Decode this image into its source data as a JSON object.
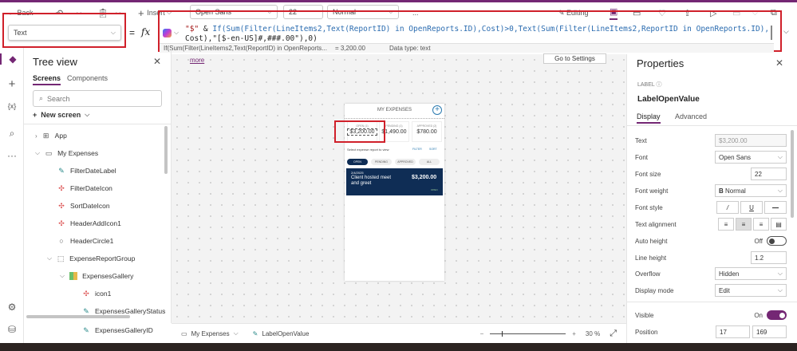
{
  "toolbar": {
    "back": "Back",
    "insert": "Insert",
    "font": "Open Sans",
    "font_size": "22",
    "font_weight": "Normal",
    "more": "...",
    "editing": "Editing"
  },
  "formula_bar": {
    "property": "Text",
    "equals": "=",
    "fx": "fx",
    "line1": [
      "\"$\"",
      " & ",
      "If(Sum(Filter(LineItems2,Text(ReportID) in OpenReports.ID),Cost)>0,Text(Sum(Filter(LineItems2,ReportID in OpenReports.ID),"
    ],
    "line2": "Cost),\"[$-en-US]#,###.00\"),0)",
    "preview": "If(Sum(Filter(LineItems2,Text(ReportID) in OpenReports...",
    "preview_value": "= 3,200.00",
    "data_type": "Data type: text"
  },
  "banner": {
    "more": "more",
    "go_settings": "Go to Settings"
  },
  "tree": {
    "title": "Tree view",
    "tabs": [
      "Screens",
      "Components"
    ],
    "search_placeholder": "Search",
    "new_screen": "New screen",
    "items": [
      "App",
      "My Expenses",
      "FilterDateLabel",
      "FilterDateIcon",
      "SortDateIcon",
      "HeaderAddIcon1",
      "HeaderCircle1",
      "ExpenseReportGroup",
      "ExpensesGallery",
      "icon1",
      "ExpensesGalleryStatus",
      "ExpensesGalleryID"
    ]
  },
  "app": {
    "title": "MY EXPENSES",
    "open_label": "OPEN (1)",
    "open_value": "$3,200.00",
    "pending_label": "PENDING (1)",
    "pending_value": "$1,490.00",
    "approved_label": "APPROVED (2)",
    "approved_value": "$780.00",
    "select_text": "Select expense report to view",
    "filter": "FILTER",
    "sort": "SORT",
    "tabs": [
      "OPEN",
      "PENDING",
      "APPROVED",
      "ALL"
    ],
    "card_date": "2/4/2025",
    "card_title": "Client hosted meet and greet",
    "card_amount": "$3,200.00",
    "card_status": "OPEN"
  },
  "properties": {
    "title": "Properties",
    "type": "LABEL",
    "name": "LabelOpenValue",
    "tabs": [
      "Display",
      "Advanced"
    ],
    "rows": [
      {
        "label": "Text",
        "value": "$3,200.00"
      },
      {
        "label": "Font",
        "value": "Open Sans"
      },
      {
        "label": "Font size",
        "value": "22"
      },
      {
        "label": "Font weight",
        "value": "Normal"
      },
      {
        "label": "Font style"
      },
      {
        "label": "Text alignment"
      },
      {
        "label": "Auto height",
        "value": "Off"
      },
      {
        "label": "Line height",
        "value": "1.2"
      },
      {
        "label": "Overflow",
        "value": "Hidden"
      },
      {
        "label": "Display mode",
        "value": "Edit"
      },
      {
        "label": "Visible",
        "value": "On"
      },
      {
        "label": "Position",
        "x": "17",
        "y": "169"
      }
    ]
  },
  "status": {
    "screen": "My Expenses",
    "control": "LabelOpenValue",
    "zoom": "30",
    "zoom_unit": "%",
    "zoom_level": 30
  }
}
